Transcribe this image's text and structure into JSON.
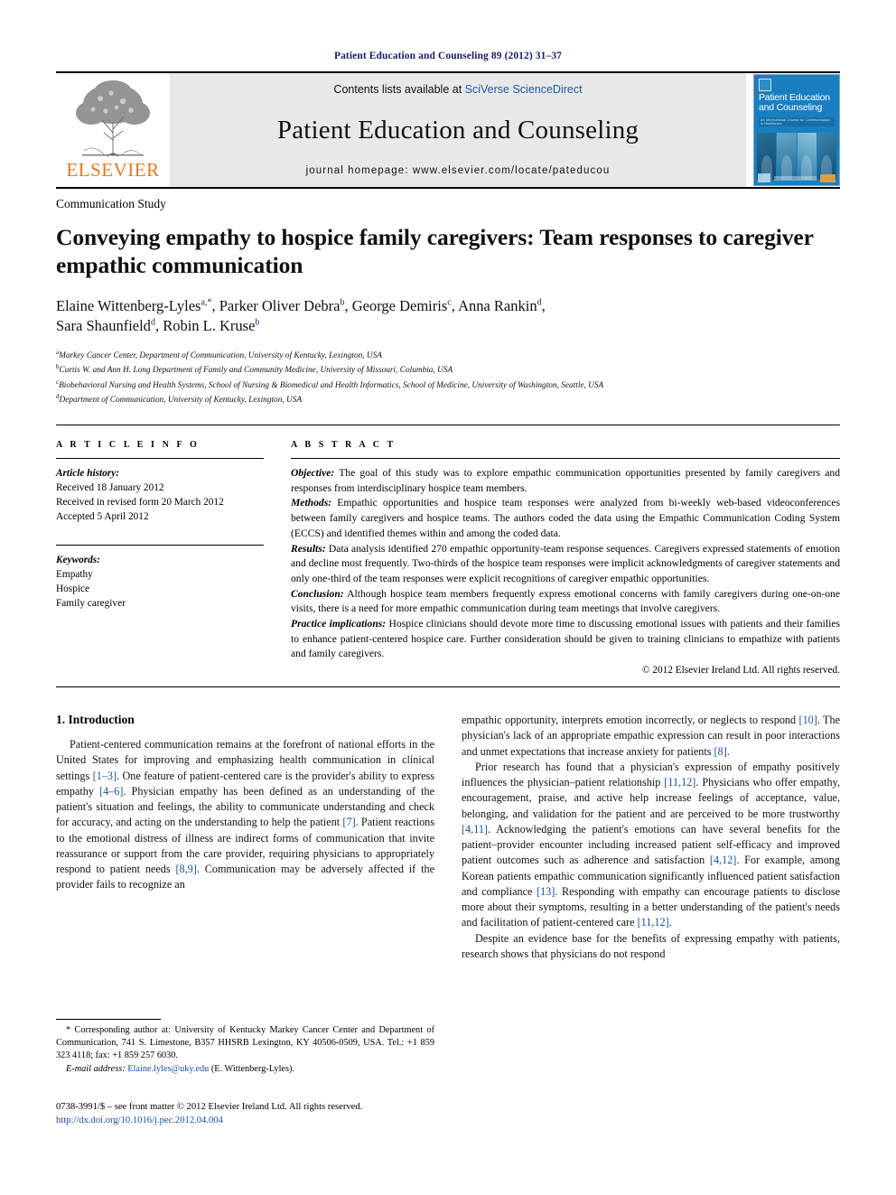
{
  "running_head": "Patient Education and Counseling 89 (2012) 31–37",
  "masthead": {
    "publisher_name": "ELSEVIER",
    "contents_prefix": "Contents lists available at",
    "contents_link": "SciVerse ScienceDirect",
    "journal_name": "Patient Education and Counseling",
    "homepage": "journal homepage: www.elsevier.com/locate/pateducou",
    "cover_title": "Patient Education and Counseling",
    "cover_subtitle": "An International Journal for Communication in Healthcare"
  },
  "article": {
    "type_label": "Communication Study",
    "title": "Conveying empathy to hospice family caregivers: Team responses to caregiver empathic communication",
    "authors": [
      {
        "name": "Elaine Wittenberg-Lyles",
        "marks": "a,*"
      },
      {
        "name": "Parker Oliver Debra",
        "marks": "b"
      },
      {
        "name": "George Demiris",
        "marks": "c"
      },
      {
        "name": "Anna Rankin",
        "marks": "d"
      },
      {
        "name": "Sara Shaunfield",
        "marks": "d"
      },
      {
        "name": "Robin L. Kruse",
        "marks": "b"
      }
    ],
    "affiliations": [
      {
        "mark": "a",
        "text": "Markey Cancer Center, Department of Communication, University of Kentucky, Lexington, USA"
      },
      {
        "mark": "b",
        "text": "Curtis W. and Ann H. Long Department of Family and Community Medicine, University of Missouri, Columbia, USA"
      },
      {
        "mark": "c",
        "text": "Biobehavioral Nursing and Health Systems, School of Nursing & Biomedical and Health Informatics, School of Medicine, University of Washington, Seattle, USA"
      },
      {
        "mark": "d",
        "text": "Department of Communication, University of Kentucky, Lexington, USA"
      }
    ]
  },
  "article_info": {
    "heading": "A R T I C L E  I N F O",
    "history_label": "Article history:",
    "history": [
      "Received 18 January 2012",
      "Received in revised form 20 March 2012",
      "Accepted 5 April 2012"
    ],
    "keywords_label": "Keywords:",
    "keywords": [
      "Empathy",
      "Hospice",
      "Family caregiver"
    ]
  },
  "abstract": {
    "heading": "A B S T R A C T",
    "sections": [
      {
        "label": "Objective:",
        "text": "The goal of this study was to explore empathic communication opportunities presented by family caregivers and responses from interdisciplinary hospice team members."
      },
      {
        "label": "Methods:",
        "text": "Empathic opportunities and hospice team responses were analyzed from bi-weekly web-based videoconferences between family caregivers and hospice teams. The authors coded the data using the Empathic Communication Coding System (ECCS) and identified themes within and among the coded data."
      },
      {
        "label": "Results:",
        "text": "Data analysis identified 270 empathic opportunity-team response sequences. Caregivers expressed statements of emotion and decline most frequently. Two-thirds of the hospice team responses were implicit acknowledgments of caregiver statements and only one-third of the team responses were explicit recognitions of caregiver empathic opportunities."
      },
      {
        "label": "Conclusion:",
        "text": "Although hospice team members frequently express emotional concerns with family caregivers during one-on-one visits, there is a need for more empathic communication during team meetings that involve caregivers."
      },
      {
        "label": "Practice implications:",
        "text": "Hospice clinicians should devote more time to discussing emotional issues with patients and their families to enhance patient-centered hospice care. Further consideration should be given to training clinicians to empathize with patients and family caregivers."
      }
    ],
    "copyright": "© 2012 Elsevier Ireland Ltd. All rights reserved."
  },
  "body": {
    "section_heading": "1. Introduction",
    "left_paragraphs": [
      "Patient-centered communication remains at the forefront of national efforts in the United States for improving and emphasizing health communication in clinical settings [1–3]. One feature of patient-centered care is the provider's ability to express empathy [4–6]. Physician empathy has been defined as an understanding of the patient's situation and feelings, the ability to communicate understanding and check for accuracy, and acting on the understanding to help the patient [7]. Patient reactions to the emotional distress of illness are indirect forms of communication that invite reassurance or support from the care provider, requiring physicians to appropriately respond to patient needs [8,9]. Communication may be adversely affected if the provider fails to recognize an"
    ],
    "right_paragraphs": [
      "empathic opportunity, interprets emotion incorrectly, or neglects to respond [10]. The physician's lack of an appropriate empathic expression can result in poor interactions and unmet expectations that increase anxiety for patients [8].",
      "Prior research has found that a physician's expression of empathy positively influences the physician–patient relationship [11,12]. Physicians who offer empathy, encouragement, praise, and active help increase feelings of acceptance, value, belonging, and validation for the patient and are perceived to be more trustworthy [4,11]. Acknowledging the patient's emotions can have several benefits for the patient–provider encounter including increased patient self-efficacy and improved patient outcomes such as adherence and satisfaction [4,12]. For example, among Korean patients empathic communication significantly influenced patient satisfaction and compliance [13]. Responding with empathy can encourage patients to disclose more about their symptoms, resulting in a better understanding of the patient's needs and facilitation of patient-centered care [11,12].",
      "Despite an evidence base for the benefits of expressing empathy with patients, research shows that physicians do not respond"
    ]
  },
  "footnotes": {
    "corresponding": "* Corresponding author at: University of Kentucky Markey Cancer Center and Department of Communication, 741 S. Limestone, B357 HHSRB Lexington, KY 40506-0509, USA. Tel.: +1 859 323 4118; fax: +1 859 257 6030.",
    "email_label": "E-mail address:",
    "email": "Elaine.lyles@uky.edu",
    "email_owner": "(E. Wittenberg-Lyles).",
    "imprint": "0738-3991/$ – see front matter © 2012 Elsevier Ireland Ltd. All rights reserved.",
    "doi": "http://dx.doi.org/10.1016/j.pec.2012.04.004"
  }
}
